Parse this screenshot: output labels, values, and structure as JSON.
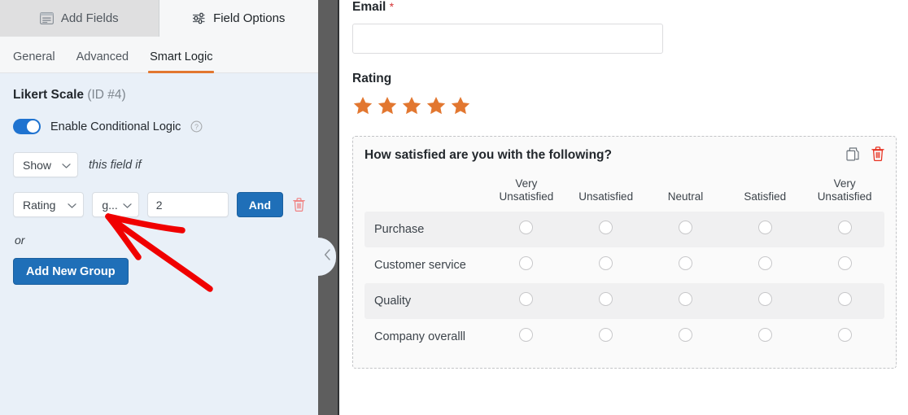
{
  "builder": {
    "tabs": [
      {
        "label": "Add Fields",
        "icon": "fields-list-icon",
        "active": false
      },
      {
        "label": "Field Options",
        "icon": "sliders-icon",
        "active": true
      }
    ],
    "subtabs": [
      {
        "label": "General",
        "active": false
      },
      {
        "label": "Advanced",
        "active": false
      },
      {
        "label": "Smart Logic",
        "active": true
      }
    ],
    "accent_color": "#e27730"
  },
  "options_panel": {
    "field_name": "Likert Scale",
    "field_id": "(ID #4)",
    "toggle_label": "Enable Conditional Logic",
    "toggle_on": true,
    "help_icon": "question-circle-icon",
    "action_select": "Show",
    "action_suffix": "this field if",
    "condition": {
      "field": "Rating",
      "operator": "g...",
      "value": "2",
      "and_label": "And",
      "delete_icon": "trash-icon"
    },
    "or_label": "or",
    "add_group_label": "Add New Group",
    "chevron_icon": "chevron-down-icon"
  },
  "divider": {
    "collapse_icon": "chevron-left-icon"
  },
  "preview": {
    "email_field": {
      "label": "Email",
      "required_mark": "*",
      "value": "",
      "placeholder": ""
    },
    "rating_field": {
      "label": "Rating",
      "star_count": 5,
      "star_color": "#e27730",
      "star_icon": "star-icon"
    },
    "likert_field": {
      "question": "How satisfied are you with the following?",
      "duplicate_icon": "duplicate-icon",
      "delete_icon": "trash-icon",
      "columns": [
        "Very Unsatisfied",
        "Unsatisfied",
        "Neutral",
        "Satisfied",
        "Very Unsatisfied"
      ],
      "rows": [
        "Purchase",
        "Customer service",
        "Quality",
        "Company overalll"
      ]
    }
  },
  "annotation": {
    "type": "red-arrow",
    "color": "#f00000",
    "points_to": "operator-select"
  }
}
